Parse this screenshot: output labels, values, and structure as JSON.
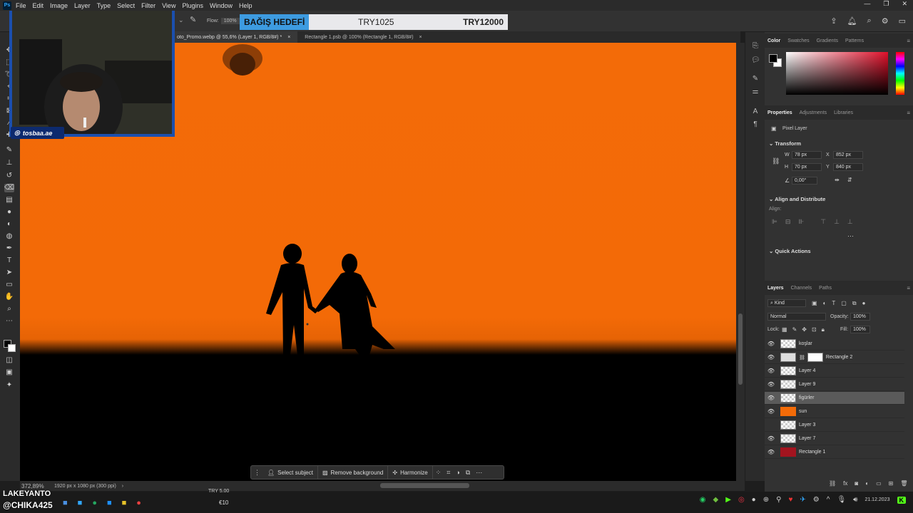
{
  "menu": [
    "File",
    "Edit",
    "Image",
    "Layer",
    "Type",
    "Select",
    "Filter",
    "View",
    "Plugins",
    "Window",
    "Help"
  ],
  "options_bar": {
    "flow_label": "Flow:",
    "flow_value": "100%"
  },
  "donation": {
    "title": "BAĞIŞ HEDEFİ",
    "current": "TRY1025",
    "goal": "TRY12000"
  },
  "tabs": [
    {
      "label": "oto_Promo.webp @ 55,6% (Layer 1, RGB/8#) *",
      "close": "×"
    },
    {
      "label": "Rectangle 1.psb @ 100% (Rectangle 1, RGB/8#)",
      "close": "×"
    }
  ],
  "status": {
    "zoom": "372,89%",
    "doc_size": "1920 px x 1080 px (300 ppi)"
  },
  "context_bar": {
    "select_subject": "Select subject",
    "remove_background": "Remove background",
    "harmonize": "Harmonize"
  },
  "color_panel": {
    "tabs": [
      "Color",
      "Swatches",
      "Gradients",
      "Patterns"
    ]
  },
  "properties_panel": {
    "tabs": [
      "Properties",
      "Adjustments",
      "Libraries"
    ],
    "layer_type": "Pixel Layer",
    "transform_title": "Transform",
    "w_label": "W",
    "w_value": "78 px",
    "h_label": "H",
    "h_value": "70 px",
    "x_label": "X",
    "x_value": "852 px",
    "y_label": "Y",
    "y_value": "840 px",
    "angle_value": "0,00°",
    "align_title": "Align and Distribute",
    "align_label": "Align:",
    "quick_actions_title": "Quick Actions"
  },
  "layers_panel": {
    "tabs": [
      "Layers",
      "Channels",
      "Paths"
    ],
    "filter_kind": "Kind",
    "blend_mode": "Normal",
    "opacity_label": "Opacity:",
    "opacity_value": "100%",
    "lock_label": "Lock:",
    "fill_label": "Fill:",
    "fill_value": "100%",
    "layers": [
      {
        "name": "koşlar",
        "visible": true
      },
      {
        "name": "Rectangle 2",
        "visible": true
      },
      {
        "name": "Layer 4",
        "visible": true
      },
      {
        "name": "Layer 9",
        "visible": true
      },
      {
        "name": "figürler",
        "visible": true,
        "selected": true
      },
      {
        "name": "sun",
        "visible": true
      },
      {
        "name": "Layer 3",
        "visible": false
      },
      {
        "name": "Layer 7",
        "visible": true
      },
      {
        "name": "Rectangle 1",
        "visible": true
      }
    ]
  },
  "overlay": {
    "instagram_handle": "tosbaa.ae",
    "stream_name": "LAKEYANTO",
    "stream_user": "@CHIKA425",
    "tip_line": "TRY 5.00",
    "tip_amount": "€10"
  },
  "taskbar": {
    "date": "21.12.2023"
  },
  "colors": {
    "canvas_orange": "#f36b08",
    "accent_blue": "#3d9be0",
    "webcam_border": "#1b4fae"
  }
}
